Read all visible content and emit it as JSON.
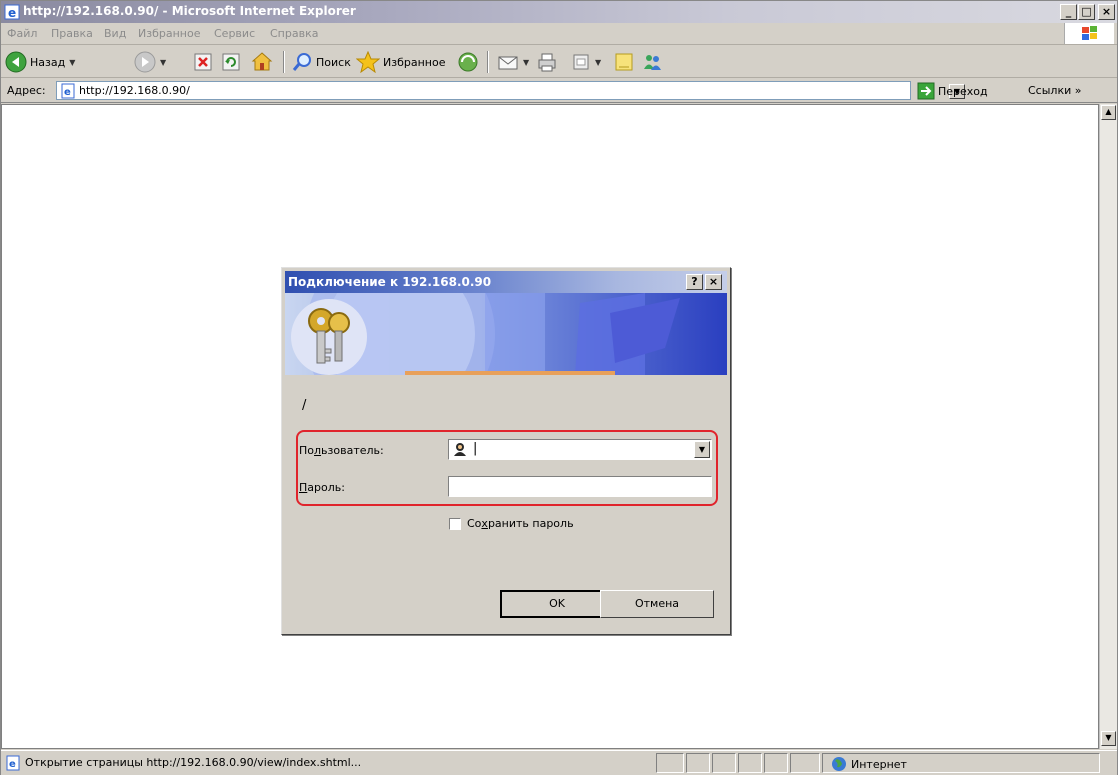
{
  "window": {
    "title": "http://192.168.0.90/ - Microsoft Internet Explorer",
    "min_glyph": "_",
    "max_glyph": "□",
    "close_glyph": "×"
  },
  "menu": {
    "items": [
      "Файл",
      "Правка",
      "Вид",
      "Избранное",
      "Сервис",
      "Справка"
    ]
  },
  "toolbar": {
    "back_label": "Назад",
    "search_label": "Поиск",
    "favorites_label": "Избранное"
  },
  "address": {
    "label": "Адрес:",
    "url": "http://192.168.0.90/",
    "go_label": "Переход",
    "links_label": "Ссылки »"
  },
  "status": {
    "text": "Открытие страницы http://192.168.0.90/view/index.shtml...",
    "zone": "Интернет"
  },
  "dialog": {
    "title": "Подключение к 192.168.0.90",
    "help_glyph": "?",
    "close_glyph": "×",
    "realm": "/",
    "user_label_pre": "По",
    "user_label_acc": "л",
    "user_label_post": "ьзователь:",
    "user_value": "|",
    "password_label_acc": "П",
    "password_label_post": "ароль:",
    "password_value": "",
    "remember_label_pre": "Со",
    "remember_label_acc": "х",
    "remember_label_post": "ранить пароль",
    "remember_checked": false,
    "ok_label": "OK",
    "cancel_label": "Отмена"
  },
  "colors": {
    "highlight_outline": "#e0242c",
    "dialog_title": "#2f4fb0"
  }
}
